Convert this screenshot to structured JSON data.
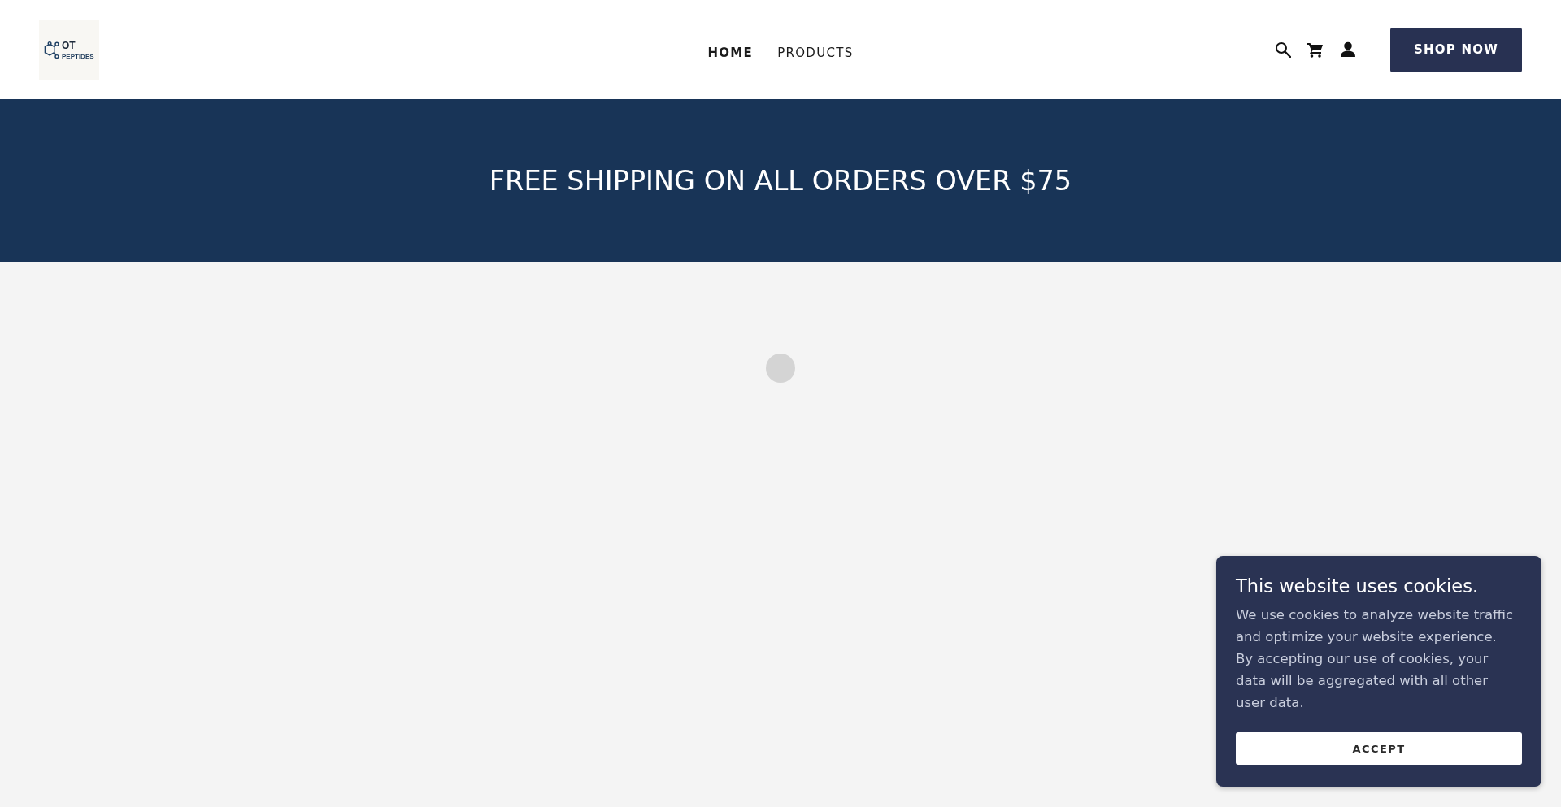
{
  "header": {
    "logo": {
      "brand": "OT",
      "tagline": "PEPTIDES"
    },
    "nav": [
      {
        "label": "HOME",
        "selected": true
      },
      {
        "label": "PRODUCTS",
        "selected": false
      }
    ],
    "shop_button": "SHOP NOW"
  },
  "banner": {
    "text": "FREE SHIPPING ON ALL ORDERS OVER $75"
  },
  "content": {
    "loading": true
  },
  "cookie_notice": {
    "title": "This website uses cookies.",
    "body": "We use cookies to analyze website traffic and optimize your website experience. By accepting our use of cookies, your data will be aggregated with all other user data.",
    "button": "ACCEPT"
  }
}
